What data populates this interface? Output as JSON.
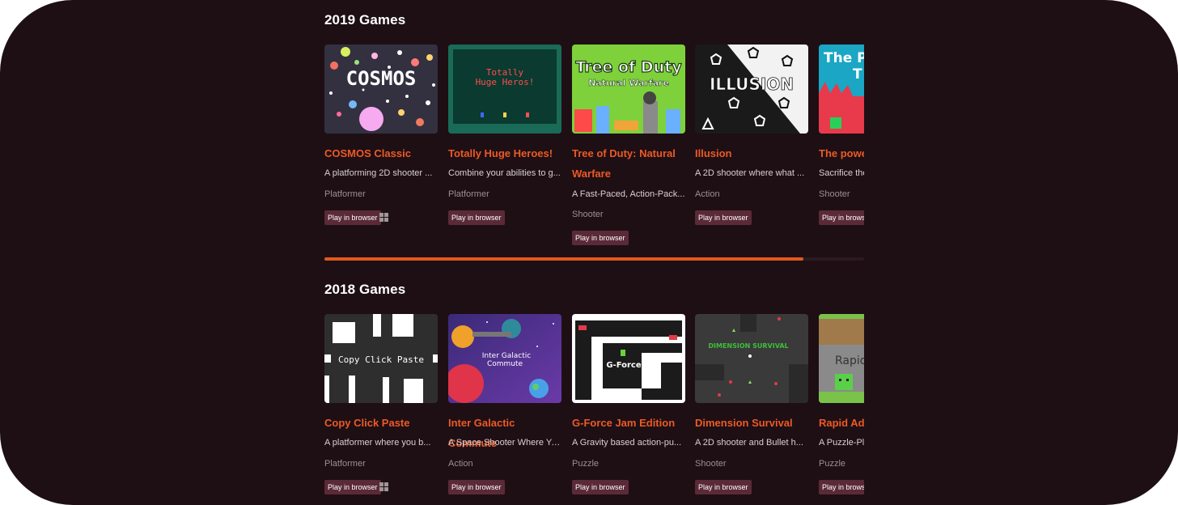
{
  "sections": [
    {
      "title": "2019 Games",
      "games": [
        {
          "title": "COSMOS Classic",
          "thumb_text": "COSMOS",
          "desc": "A platforming 2D shooter ...",
          "genre": "Platformer",
          "play": "Play in browser",
          "windows": true
        },
        {
          "title": "Totally Huge Heroes!",
          "thumb_text": "Totally\nHuge Heros!",
          "desc": "Combine your abilities to g...",
          "genre": "Platformer",
          "play": "Play in browser",
          "windows": false
        },
        {
          "title": "Tree of Duty: Natural Warfare",
          "thumb_text": "Tree of Duty Natural Warfare",
          "desc": "A Fast-Paced, Action-Pack...",
          "genre": "Shooter",
          "play": "Play in browser",
          "windows": false
        },
        {
          "title": "Illusion",
          "thumb_text": "ILLUSION",
          "desc": "A 2D shooter where what ...",
          "genre": "Action",
          "play": "Play in browser",
          "windows": false
        },
        {
          "title": "The power",
          "thumb_text": "The P T",
          "desc": "Sacrifice the",
          "genre": "Shooter",
          "play": "Play in browser",
          "windows": false
        }
      ]
    },
    {
      "title": "2018 Games",
      "games": [
        {
          "title": "Copy Click Paste",
          "thumb_text": "Copy Click Paste",
          "desc": "A platformer where you b...",
          "genre": "Platformer",
          "play": "Play in browser",
          "windows": true
        },
        {
          "title": "Inter Galactic Commute",
          "thumb_text": "Inter Galactic Commute",
          "desc": "A Space Shooter Where Yo...",
          "genre": "Action",
          "play": "Play in browser",
          "windows": false
        },
        {
          "title": "G-Force Jam Edition",
          "thumb_text": "G-Force",
          "desc": "A Gravity based action-pu...",
          "genre": "Puzzle",
          "play": "Play in browser",
          "windows": false
        },
        {
          "title": "Dimension Survival",
          "thumb_text": "DIMENSION SURVIVAL",
          "desc": "A 2D shooter and Bullet h...",
          "genre": "Shooter",
          "play": "Play in browser",
          "windows": false
        },
        {
          "title": "Rapid Ada",
          "thumb_text": "Rapid",
          "desc": "A Puzzle-Pl",
          "genre": "Puzzle",
          "play": "Play in browser",
          "windows": false
        }
      ]
    }
  ],
  "colors": {
    "background": "#1e0f15",
    "accent": "#ec5a24",
    "button": "#5a2a38"
  },
  "icons": {
    "platform": "windows-icon"
  }
}
